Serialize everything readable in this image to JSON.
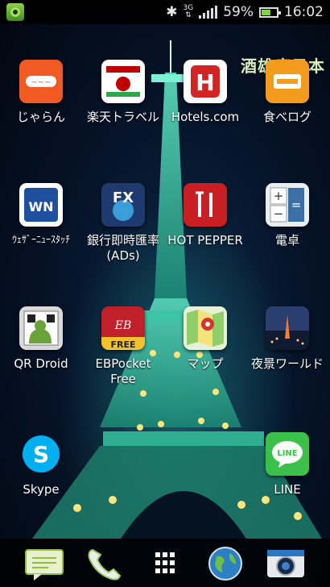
{
  "status_bar": {
    "battery": "59%",
    "time": "16:02",
    "network": "3G"
  },
  "wallpaper": {
    "watermark": "酒雄瘋日本"
  },
  "apps": [
    {
      "label": "じゃらん",
      "icon": "jalan-icon",
      "color": "#f25a23"
    },
    {
      "label": "楽天トラベル",
      "icon": "rakuten-travel-icon",
      "color": "#bf0000"
    },
    {
      "label": "Hotels.com",
      "icon": "hotels-icon",
      "color": "#d32323"
    },
    {
      "label": "食べログ",
      "icon": "tabelog-icon",
      "color": "#f29b1d"
    },
    {
      "label": "ｳｪｻﾞｰﾆｭｰｽﾀｯﾁ",
      "icon": "weathernews-icon",
      "color": "#1f4f9f"
    },
    {
      "label": "銀行即時匯率(ADs)",
      "icon": "fx-rates-icon",
      "color": "#1f3a6e"
    },
    {
      "label": "HOT PEPPER",
      "icon": "hotpepper-icon",
      "color": "#c81f25"
    },
    {
      "label": "電卓",
      "icon": "calculator-icon",
      "color": "#3b6fa8"
    },
    {
      "label": "QR Droid",
      "icon": "qr-droid-icon",
      "color": "#6aa33a"
    },
    {
      "label": "EBPocket Free",
      "icon": "ebpocket-icon",
      "color": "#c0202a"
    },
    {
      "label": "マップ",
      "icon": "maps-icon",
      "color": "#4caf50"
    },
    {
      "label": "夜景ワールド",
      "icon": "night-view-icon",
      "color": "#2a3e70"
    },
    {
      "label": "Skype",
      "icon": "skype-icon",
      "color": "#00aff0"
    },
    {
      "label": "LINE",
      "icon": "line-icon",
      "color": "#3bc04b"
    }
  ],
  "dock": [
    {
      "icon": "messages-icon"
    },
    {
      "icon": "phone-icon"
    },
    {
      "icon": "app-drawer-icon"
    },
    {
      "icon": "browser-globe-icon"
    },
    {
      "icon": "camera-icon"
    }
  ]
}
